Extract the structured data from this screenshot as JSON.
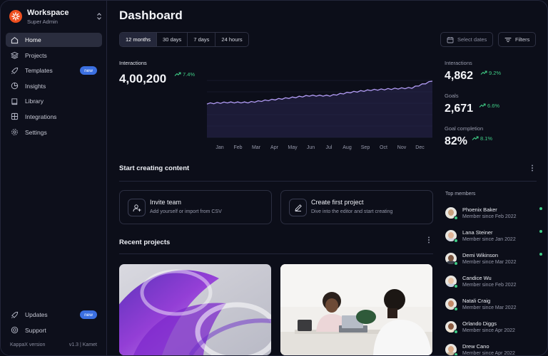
{
  "workspace": {
    "name": "Workspace",
    "role": "Super Admin"
  },
  "nav": [
    {
      "label": "Home",
      "icon": "home-icon",
      "active": true
    },
    {
      "label": "Projects",
      "icon": "layers-icon"
    },
    {
      "label": "Templates",
      "icon": "rocket-icon",
      "badge": "new"
    },
    {
      "label": "Insights",
      "icon": "pie-chart-icon"
    },
    {
      "label": "Library",
      "icon": "book-icon"
    },
    {
      "label": "Integrations",
      "icon": "integrations-icon"
    },
    {
      "label": "Settings",
      "icon": "gear-icon"
    }
  ],
  "nav_bottom": [
    {
      "label": "Updates",
      "icon": "rocket-icon",
      "badge": "new"
    },
    {
      "label": "Support",
      "icon": "lifebuoy-icon"
    }
  ],
  "version": {
    "label": "KappaX version",
    "value": "v1.3 | Kamet"
  },
  "page_title": "Dashboard",
  "ranges": [
    "12 months",
    "30 days",
    "7 days",
    "24 hours"
  ],
  "selected_range": "12 months",
  "toolbar": {
    "select_dates": "Select dates",
    "filters": "Filters"
  },
  "main_metric": {
    "label": "Interactions",
    "value": "4,00,200",
    "delta": "7.4%"
  },
  "stats": [
    {
      "label": "Interactions",
      "value": "4,862",
      "delta": "9.2%"
    },
    {
      "label": "Goals",
      "value": "2,671",
      "delta": "6.6%"
    },
    {
      "label": "Goal completion",
      "value": "82%",
      "delta": "8.1%"
    }
  ],
  "chart_data": {
    "type": "area",
    "categories": [
      "Jan",
      "Feb",
      "Mar",
      "Apr",
      "May",
      "Jun",
      "Jul",
      "Aug",
      "Sep",
      "Oct",
      "Nov",
      "Dec"
    ],
    "values": [
      30,
      31,
      31,
      33,
      35,
      37,
      37,
      40,
      42,
      43,
      44,
      50
    ],
    "ylim": [
      0,
      62
    ],
    "grid": true,
    "line_color": "#b39df6",
    "fill_color": "#2a2650"
  },
  "start_section": {
    "title": "Start creating content",
    "cards": [
      {
        "title": "Invite team",
        "subtitle": "Add yourself or import from CSV",
        "icon": "user-plus-icon"
      },
      {
        "title": "Create first project",
        "subtitle": "Dive into the editor and start creating",
        "icon": "pencil-icon"
      }
    ]
  },
  "recent_projects": {
    "title": "Recent projects"
  },
  "top_members": {
    "title": "Top members",
    "members": [
      {
        "name": "Phoenix Baker",
        "since": "Member since Feb 2022",
        "online": true,
        "skin": "#c9a27e",
        "shirt": "#e8e3d8"
      },
      {
        "name": "Lana Steiner",
        "since": "Member since Jan 2022",
        "online": true,
        "skin": "#e0b497",
        "shirt": "#d3d6df"
      },
      {
        "name": "Demi Wikinson",
        "since": "Member since Mar 2022",
        "online": true,
        "skin": "#7a5640",
        "shirt": "#3a3f4a"
      },
      {
        "name": "Candice Wu",
        "since": "Member since Feb 2022",
        "online": false,
        "skin": "#e6c2a4",
        "shirt": "#c8cfe0"
      },
      {
        "name": "Natali Craig",
        "since": "Member since Mar 2022",
        "online": false,
        "skin": "#c48a68",
        "shirt": "#e2dcd2"
      },
      {
        "name": "Orlando Diggs",
        "since": "Member since Apr 2022",
        "online": false,
        "skin": "#8b5c43",
        "shirt": "#efe4d0"
      },
      {
        "name": "Drew Cano",
        "since": "Member since Apr 2022",
        "online": false,
        "skin": "#d9a985",
        "shirt": "#cbb59a"
      }
    ]
  }
}
